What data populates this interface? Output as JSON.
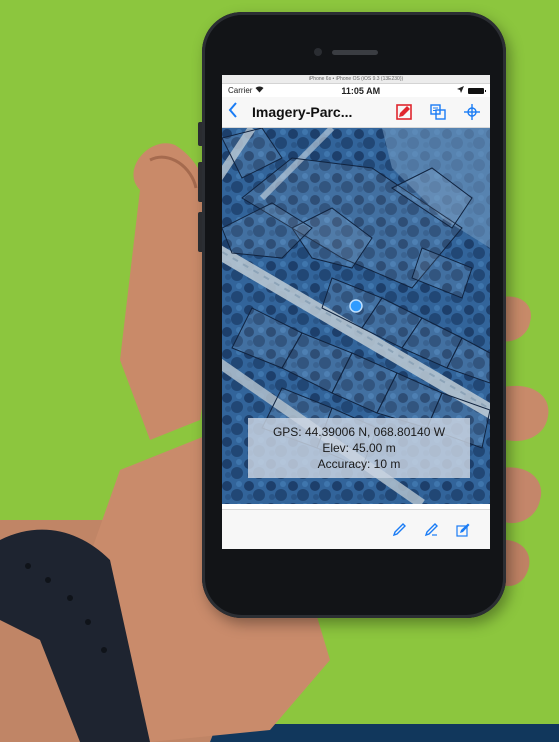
{
  "status": {
    "simulator_text": "iPhone 6s • iPhone OS (iOS 9.3 (13E230))",
    "carrier": "Carrier",
    "time": "11:05 AM"
  },
  "nav": {
    "title": "Imagery-Parc..."
  },
  "gps": {
    "coords": "GPS: 44.39006 N, 068.80140 W",
    "elevation": "Elev: 45.00 m",
    "accuracy": "Accuracy: 10 m"
  },
  "icons": {
    "back": "chevron-left-icon",
    "edit": "edit-red-icon",
    "layers": "layers-icon",
    "locate": "crosshair-icon",
    "pen1": "pen-icon",
    "pen2": "pen-alt-icon",
    "pen3": "pen-edit-icon"
  },
  "colors": {
    "background": "#8cc63e",
    "band": "#11375c",
    "accent": "#1a7cf5",
    "edit_red": "#e0262e",
    "gps_dot": "#2f9bff"
  }
}
